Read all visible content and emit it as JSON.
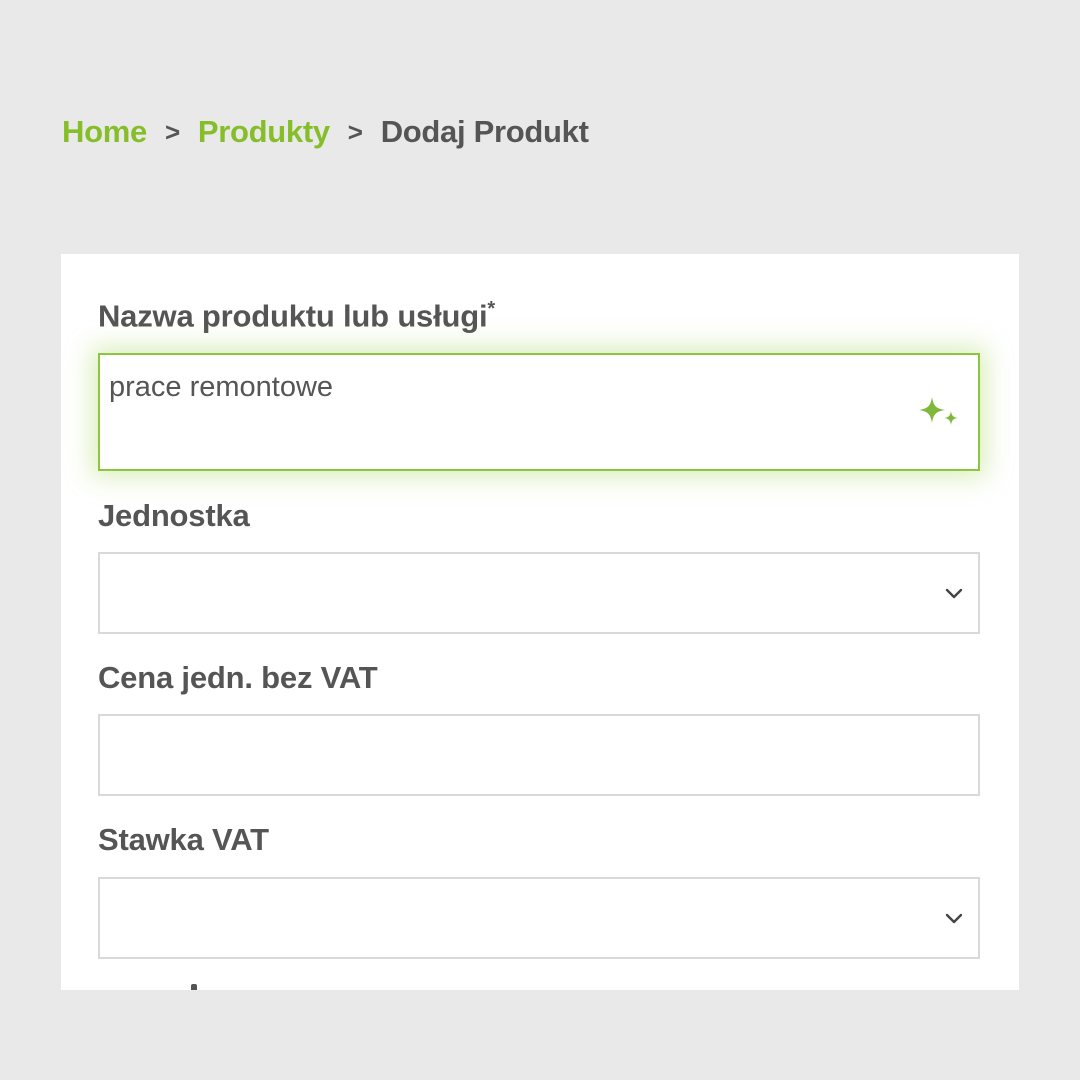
{
  "breadcrumb": {
    "home": "Home",
    "separator": ">",
    "products": "Produkty",
    "current": "Dodaj Produkt"
  },
  "form": {
    "name_field": {
      "label": "Nazwa produktu lub usługi",
      "required_mark": "*",
      "value": "prace remontowe",
      "icon": "sparkle-icon"
    },
    "unit_field": {
      "label": "Jednostka",
      "value": "",
      "icon": "chevron-down-icon"
    },
    "price_field": {
      "label": "Cena jedn. bez VAT",
      "value": ""
    },
    "vat_field": {
      "label": "Stawka VAT",
      "value": "",
      "icon": "chevron-down-icon"
    }
  },
  "colors": {
    "accent": "#86be2a",
    "text": "#555555",
    "background": "#e9e9ea",
    "card": "#ffffff",
    "border": "#d9d9d9"
  }
}
